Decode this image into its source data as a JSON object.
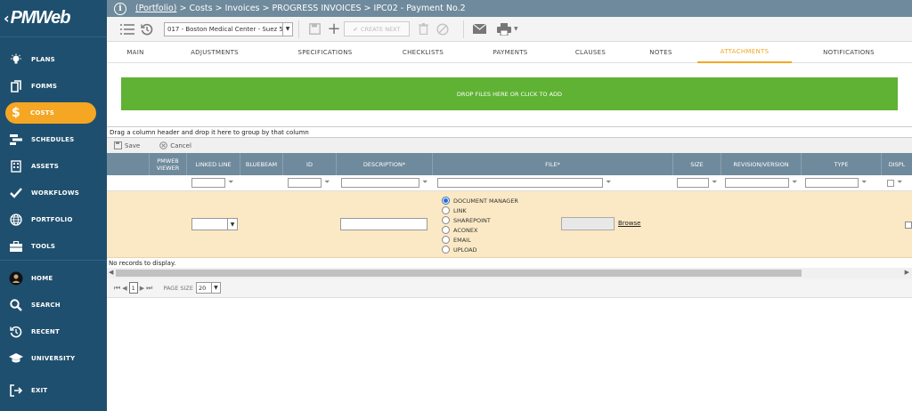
{
  "brand": {
    "logo": "PMWeb",
    "accent": "#f5a623",
    "sidebar_bg": "#1f4f6e",
    "header_bg": "#6f8a9c",
    "drop_bg": "#5fb233"
  },
  "breadcrumb": {
    "portfolio": "(Portfolio)",
    "rest": " > Costs > Invoices > PROGRESS INVOICES > IPC02 - Payment No.2"
  },
  "sidebar": {
    "items": [
      {
        "label": "PLANS",
        "icon": "lightbulb-icon"
      },
      {
        "label": "FORMS",
        "icon": "document-icon"
      },
      {
        "label": "COSTS",
        "icon": "dollar-icon"
      },
      {
        "label": "SCHEDULES",
        "icon": "schedule-icon"
      },
      {
        "label": "ASSETS",
        "icon": "building-icon"
      },
      {
        "label": "WORKFLOWS",
        "icon": "check-icon"
      },
      {
        "label": "PORTFOLIO",
        "icon": "globe-icon"
      },
      {
        "label": "TOOLS",
        "icon": "toolbox-icon"
      },
      {
        "label": "HOME",
        "icon": "avatar-icon"
      },
      {
        "label": "SEARCH",
        "icon": "search-icon"
      },
      {
        "label": "RECENT",
        "icon": "recent-icon"
      },
      {
        "label": "UNIVERSITY",
        "icon": "graduation-cap-icon"
      },
      {
        "label": "EXIT",
        "icon": "exit-icon"
      }
    ]
  },
  "toolbar": {
    "project": "017 - Boston Medical Center - Suez 5",
    "create_next": "CREATE NEXT"
  },
  "tabs": [
    "MAIN",
    "ADJUSTMENTS",
    "SPECIFICATIONS",
    "CHECKLISTS",
    "PAYMENTS",
    "CLAUSES",
    "NOTES",
    "ATTACHMENTS",
    "NOTIFICATIONS"
  ],
  "dropzone": {
    "label": "DROP FILES HERE OR CLICK TO ADD"
  },
  "grid": {
    "group_hint": "Drag a column header and drop it here to group by that column",
    "save": "Save",
    "cancel": "Cancel",
    "columns": [
      "PMWEB VIEWER",
      "LINKED LINE",
      "BLUEBEAM",
      "ID",
      "DESCRIPTION*",
      "FILE*",
      "SIZE",
      "REVISION/VERSION",
      "TYPE",
      "DISPL"
    ],
    "file_sources": [
      "DOCUMENT MANAGER",
      "LINK",
      "SHAREPOINT",
      "ACONEX",
      "EMAIL",
      "UPLOAD"
    ],
    "selected_source": "DOCUMENT MANAGER",
    "browse": "Browse",
    "no_records": "No records to display.",
    "page_number": "1",
    "page_size_label": "PAGE SIZE",
    "page_size": "20"
  }
}
